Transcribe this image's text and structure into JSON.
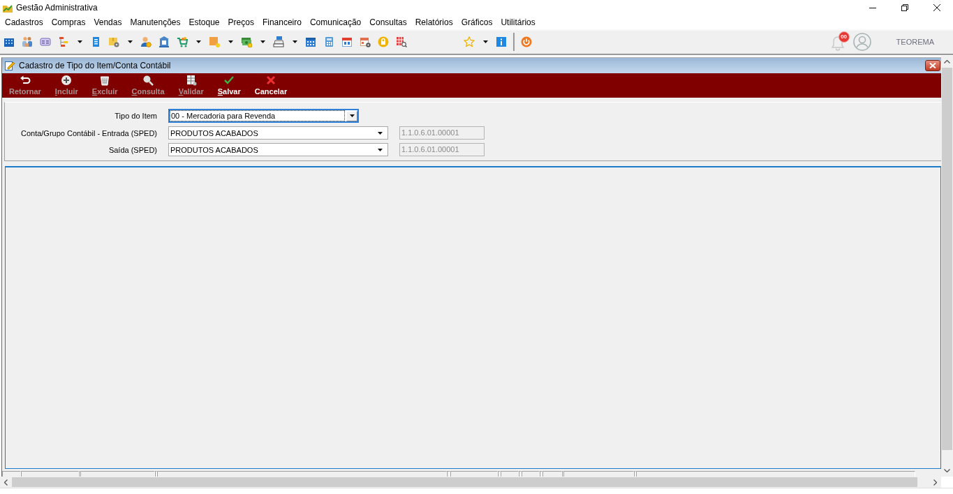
{
  "window": {
    "title": "Gestão Administrativa"
  },
  "menu": [
    "Cadastros",
    "Compras",
    "Vendas",
    "Manutenções",
    "Estoque",
    "Preços",
    "Financeiro",
    "Comunicação",
    "Consultas",
    "Relatórios",
    "Gráficos",
    "Utilitários"
  ],
  "toolbar": {
    "groups": [
      {
        "items": [
          {
            "kind": "button"
          },
          {
            "kind": "button"
          },
          {
            "kind": "button"
          },
          {
            "kind": "split"
          },
          {
            "kind": "button"
          },
          {
            "kind": "split"
          },
          {
            "kind": "button"
          },
          {
            "kind": "button"
          },
          {
            "kind": "split"
          },
          {
            "kind": "split"
          },
          {
            "kind": "split"
          },
          {
            "kind": "split"
          },
          {
            "kind": "button"
          },
          {
            "kind": "button"
          },
          {
            "kind": "button"
          },
          {
            "kind": "button"
          },
          {
            "kind": "button"
          },
          {
            "kind": "button"
          }
        ]
      },
      {
        "items": [
          {
            "kind": "split"
          },
          {
            "kind": "button"
          },
          {
            "kind": "separator"
          },
          {
            "kind": "button"
          }
        ]
      }
    ]
  },
  "notifications": {
    "badge": "00"
  },
  "user": {
    "name": "TEOREMA"
  },
  "form_window": {
    "title": "Cadastro de Tipo do Item/Conta Contábil",
    "actions": [
      {
        "label": "Retornar",
        "disabled": true,
        "mnemonic": false
      },
      {
        "label": "Incluir",
        "disabled": true,
        "mnemonic": true
      },
      {
        "label": "Excluir",
        "disabled": true,
        "mnemonic": true
      },
      {
        "label": "Consulta",
        "disabled": true,
        "mnemonic": true
      },
      {
        "label": "Validar",
        "disabled": true,
        "mnemonic": true
      },
      {
        "label": "Salvar",
        "disabled": false,
        "mnemonic": true
      },
      {
        "label": "Cancelar",
        "disabled": false,
        "mnemonic": false
      }
    ],
    "fields": [
      {
        "label": "Tipo do Item",
        "kind": "dropdown",
        "value": "00 - Mercadoria para Revenda",
        "focused": true
      },
      {
        "label": "Conta/Grupo Contábil - Entrada (SPED)",
        "kind": "combo",
        "value": "PRODUTOS ACABADOS",
        "code": "1.1.0.6.01.00001",
        "focused": false
      },
      {
        "label": "Saída (SPED)",
        "kind": "combo",
        "value": "PRODUTOS ACABADOS",
        "code": "1.1.0.6.01.00001",
        "focused": false
      }
    ]
  }
}
